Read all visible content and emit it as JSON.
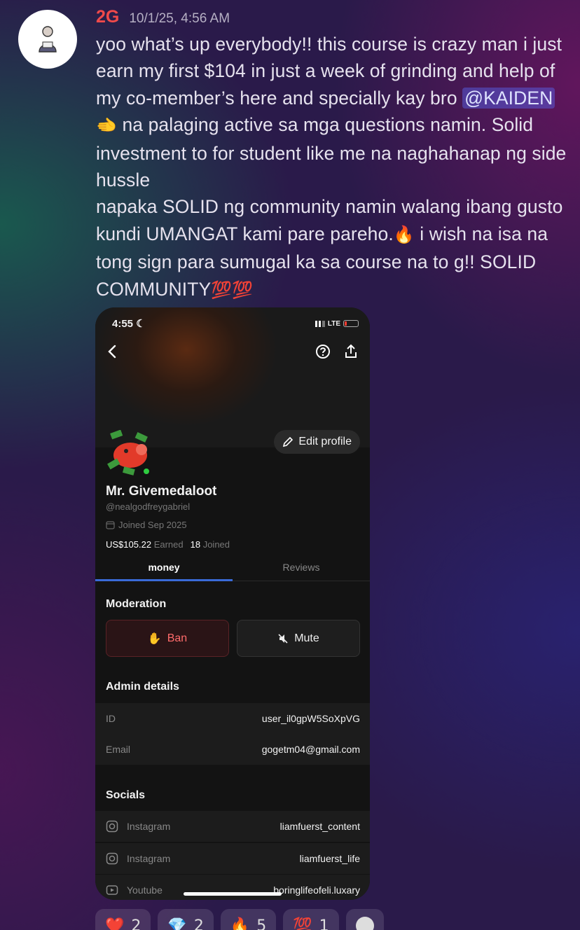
{
  "message": {
    "username": "2G",
    "timestamp": "10/1/25, 4:56 AM",
    "line1": "yoo what’s up everybody!! this course is crazy man i just earn my first $104 in just a week of grinding and help of my co-member’s here and specially kay bro ",
    "mention": "@KAIDEN",
    "point_emoji": "🫲",
    "line2": " na palaging active sa mga questions namin. Solid investment to for student like me na naghahanap ng side hussle",
    "line3": "napaka SOLID ng community namin walang ibang gusto kundi UMANGAT kami pare pareho.",
    "fire_emoji": "🔥",
    "line4": " i wish na isa na tong sign para sumugal ka sa course na to g!!  SOLID COMMUNITY",
    "hundred_emoji": "💯💯"
  },
  "phone": {
    "status_time": "4:55",
    "moon": "☾",
    "network": "LTE",
    "edit_profile": "Edit profile",
    "profile_name": "Mr. Givemedaloot",
    "handle": "@nealgodfreygabriel",
    "joined": "Joined Sep 2025",
    "earned_value": "US$105.22",
    "earned_label": "Earned",
    "joined_count": "18",
    "joined_count_label": "Joined",
    "tabs": [
      "money",
      "Reviews"
    ],
    "moderation_title": "Moderation",
    "ban_label": "Ban",
    "mute_label": "Mute",
    "admin_title": "Admin details",
    "id_label": "ID",
    "id_value": "user_il0gpW5SoXpVG",
    "email_label": "Email",
    "email_value": "gogetm04@gmail.com",
    "socials_title": "Socials",
    "socials": [
      {
        "platform": "Instagram",
        "handle": "liamfuerst_content"
      },
      {
        "platform": "Instagram",
        "handle": "liamfuerst_life"
      },
      {
        "platform": "Youtube",
        "handle": "boringlifeofeli.luxary"
      }
    ]
  },
  "reactions": [
    {
      "emoji": "❤️",
      "count": "2"
    },
    {
      "emoji": "💎",
      "count": "2"
    },
    {
      "emoji": "🔥",
      "count": "5"
    },
    {
      "emoji": "💯",
      "count": "1"
    }
  ],
  "colors": {
    "username": "#f04a4a",
    "mention_bg": "#5865f2",
    "ban_red": "#ff6b6b",
    "tab_underline": "#3a6bd8",
    "online": "#2ecc40"
  }
}
